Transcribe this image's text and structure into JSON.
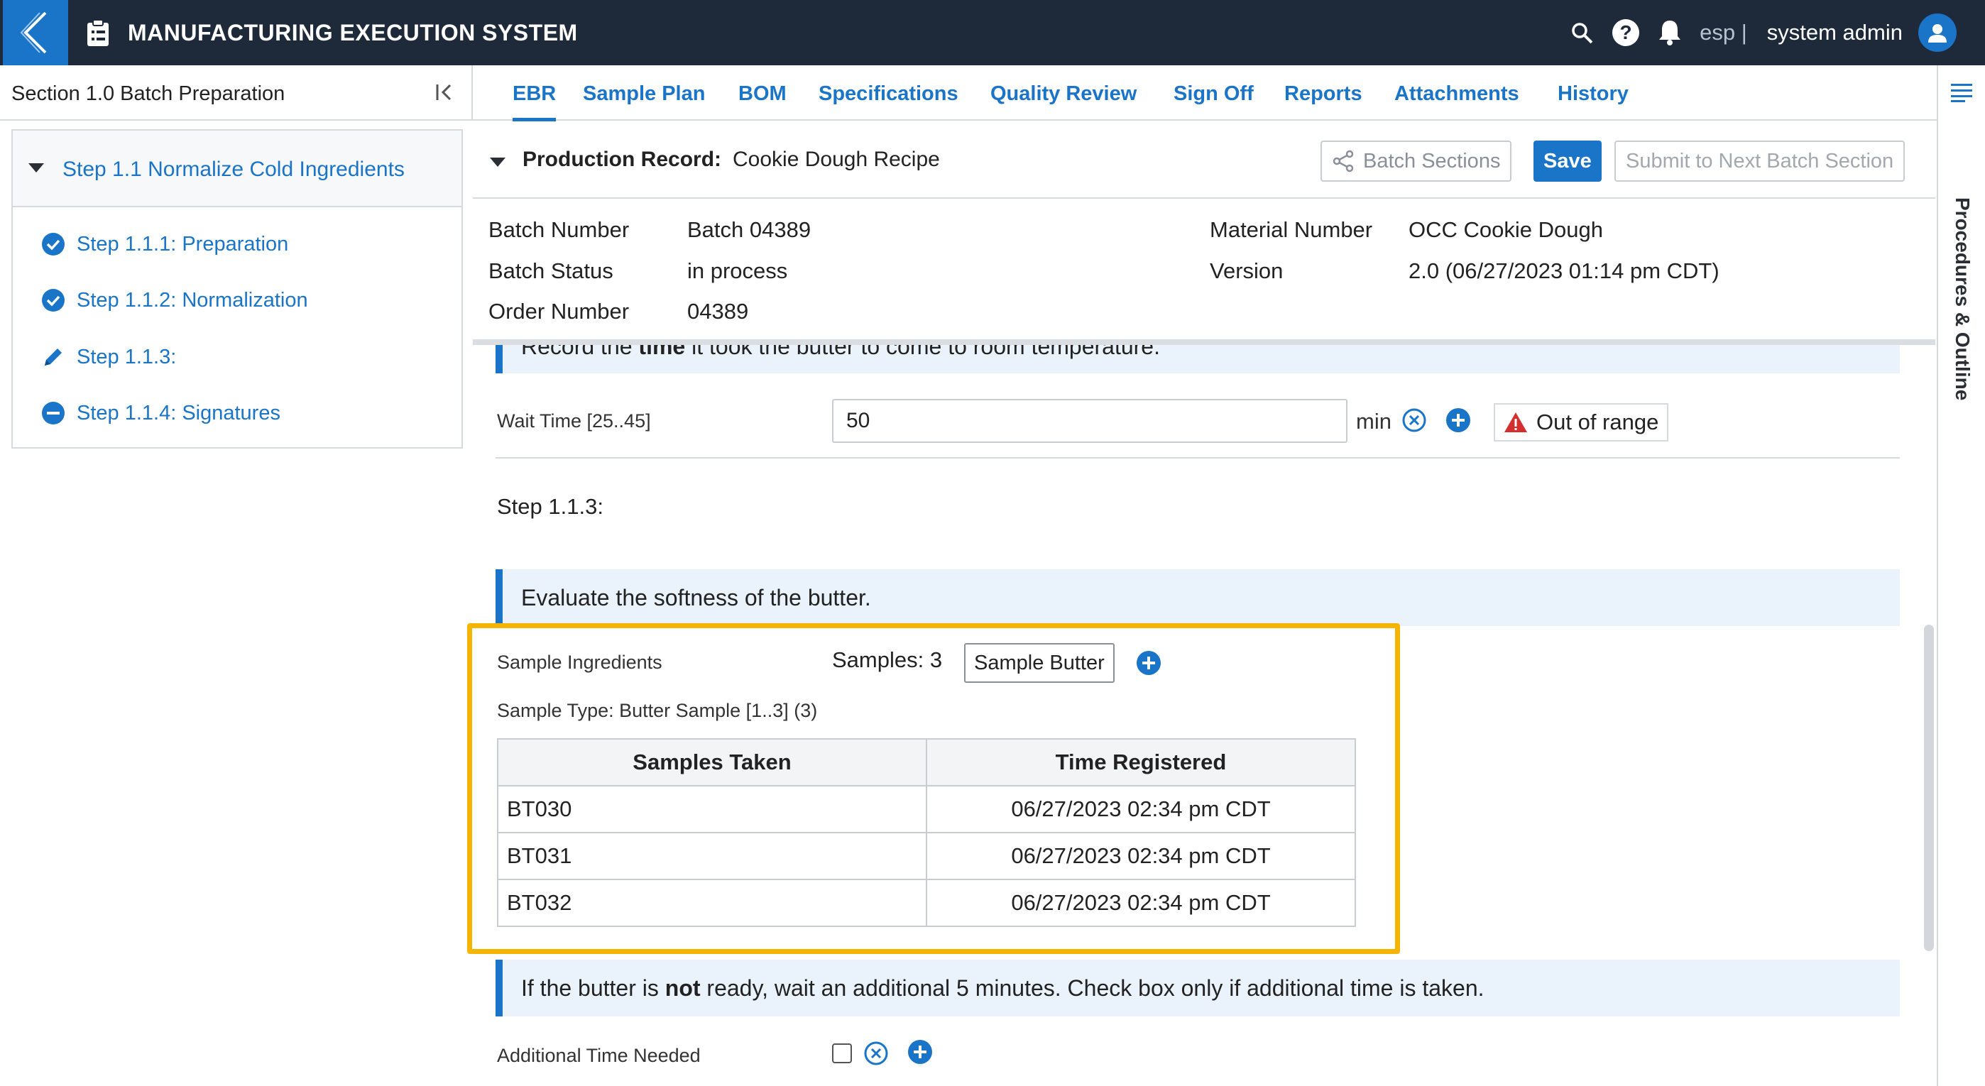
{
  "app": {
    "title": "MANUFACTURING EXECUTION SYSTEM"
  },
  "user": {
    "code": "esp |",
    "name": "system admin"
  },
  "left_panel": {
    "title": "Section 1.0 Batch Preparation",
    "root_step": "Step 1.1 Normalize Cold Ingredients",
    "steps": [
      {
        "label": "Step 1.1.1: Preparation",
        "status": "check-circle-icon"
      },
      {
        "label": "Step 1.1.2: Normalization",
        "status": "check-circle-icon"
      },
      {
        "label": "Step 1.1.3:",
        "status": "pencil-icon"
      },
      {
        "label": "Step 1.1.4: Signatures",
        "status": "minus-circle-icon"
      }
    ]
  },
  "tabs": [
    "EBR",
    "Sample Plan",
    "BOM",
    "Specifications",
    "Quality Review",
    "Sign Off",
    "Reports",
    "Attachments",
    "History"
  ],
  "active_tab": "EBR",
  "right_rail": {
    "label": "Procedures & Outline"
  },
  "production_record": {
    "label": "Production Record:",
    "value": "Cookie Dough Recipe",
    "batch_sections_label": "Batch Sections",
    "save_label": "Save",
    "submit_label": "Submit to Next Batch Section"
  },
  "batch_info": {
    "batch_number_label": "Batch Number",
    "batch_number": "Batch 04389",
    "batch_status_label": "Batch Status",
    "batch_status": "in process",
    "order_number_label": "Order Number",
    "order_number": "04389",
    "material_number_label": "Material Number",
    "material_number": "OCC Cookie Dough",
    "version_label": "Version",
    "version": "2.0 (06/27/2023 01:14 pm CDT)"
  },
  "content": {
    "instruction_1": {
      "before": "Record the ",
      "bold": "time",
      "after": " it took the butter to come to room temperature."
    },
    "wait_time": {
      "label": "Wait Time [25..45]",
      "value": "50",
      "unit": "min",
      "warning": "Out of range"
    },
    "step_title": "Step 1.1.3:",
    "instruction_2": "Evaluate the softness of the butter.",
    "sample": {
      "label": "Sample Ingredients",
      "count": "Samples: 3",
      "button": "Sample Butter",
      "type": "Sample Type: Butter Sample [1..3] (3)",
      "columns": [
        "Samples Taken",
        "Time Registered"
      ],
      "rows": [
        [
          "BT030",
          "06/27/2023 02:34 pm CDT"
        ],
        [
          "BT031",
          "06/27/2023 02:34 pm CDT"
        ],
        [
          "BT032",
          "06/27/2023 02:34 pm CDT"
        ]
      ]
    },
    "instruction_3": {
      "before": "If the butter is ",
      "bold": "not",
      "after": " ready, wait an additional 5 minutes. Check box only if additional time is taken."
    },
    "additional_time": {
      "label": "Additional Time Needed"
    }
  },
  "colors": {
    "topbar": "#1e2a39",
    "accent": "#1a74c8",
    "highlight": "#f5b400",
    "warning": "#d32f2f"
  }
}
